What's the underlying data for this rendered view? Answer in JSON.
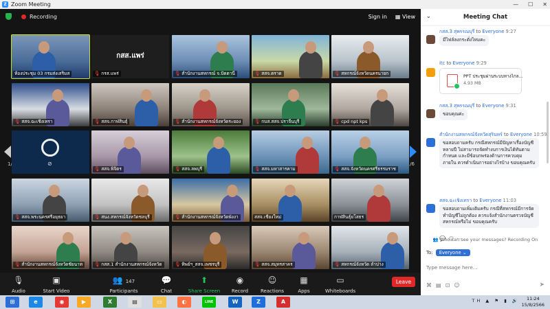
{
  "window": {
    "title": "Zoom Meeting",
    "logo": "Z",
    "controls": [
      "—",
      "☐",
      "✕"
    ]
  },
  "top": {
    "recording_label": "Recording",
    "signin_label": "Sign in",
    "view_label": "View"
  },
  "gallery": {
    "page_left": "1/6",
    "page_right": "1/6",
    "tiles": [
      {
        "name": "ห้องประชุม 03 กรมส่งเสริมส",
        "muted": false
      },
      {
        "name": "กรส.แพร่",
        "muted": true,
        "center_label": "กสส.แพร่"
      },
      {
        "name": "สำนักงานสหกรณ์ จ.ปัตตานี",
        "muted": true
      },
      {
        "name": "สสจ.ตราด",
        "muted": true
      },
      {
        "name": "สหกรณ์จังหวัดนครนายก",
        "muted": true
      },
      {
        "name": "สสจ.ฉะเชิงเทรา",
        "muted": true
      },
      {
        "name": "สสจ.กาฬสินธุ์",
        "muted": true
      },
      {
        "name": "สำนักงานสหกรณ์จังหวัดระยอง",
        "muted": true
      },
      {
        "name": "กบส.สสจ.ปราจีนบุรี",
        "muted": true
      },
      {
        "name": "cpd npt kps",
        "muted": true
      },
      {
        "name": "",
        "muted": false
      },
      {
        "name": "สสจ.พิจิตร",
        "muted": true
      },
      {
        "name": "สสจ.ลพบุรี",
        "muted": true
      },
      {
        "name": "สสจ.มหาสารคาม",
        "muted": true
      },
      {
        "name": "สสจ.จังหวัดนครศรีธรรมราช",
        "muted": true
      },
      {
        "name": "สสจ.พระนครศรีอยุธยา",
        "muted": true
      },
      {
        "name": "สนง.สหกรณ์จังหวัดชลบุรี",
        "muted": true
      },
      {
        "name": "สำนักงานสหกรณ์จังหวัดพังงา",
        "muted": true
      },
      {
        "name": "สสจ.เชียงใหม่",
        "muted": false
      },
      {
        "name": "กาฬสินธุ์ยโสธร",
        "muted": false
      },
      {
        "name": "สำนักงานสหกรณ์จังหวัดชัยนาท",
        "muted": true
      },
      {
        "name": "กสส.1 สำนักงานสหกรณ์จังหวัด",
        "muted": true
      },
      {
        "name": "ทิพย์ฯ_สสจ.เพชรบุรี",
        "muted": true
      },
      {
        "name": "สสจ.สมุทรสาคร",
        "muted": true
      },
      {
        "name": "สหกรณ์จังหวัด ลำปาง",
        "muted": true
      }
    ]
  },
  "toolbar": {
    "audio": "Audio",
    "video": "Start Video",
    "participants": "Participants",
    "participants_count": "147",
    "chat": "Chat",
    "share": "Share Screen",
    "record": "Record",
    "reactions": "Reactions",
    "apps": "Apps",
    "whiteboards": "Whiteboards",
    "leave": "Leave"
  },
  "chat": {
    "title": "Meeting Chat",
    "messages": [
      {
        "sender": "กสส.3 สุพรรณบุรี",
        "to": "to",
        "audience": "Everyone",
        "time": "9:27",
        "text": "มีไฟล์ลงกระดั่งไหมคะ",
        "avatar_color": "#6b4a3a"
      },
      {
        "sender": "itc",
        "to": "to",
        "audience": "Everyone",
        "time": "9:29",
        "file_name": "PPT ประชุมผ่านระบบทางไกล...",
        "file_size": "4.93 MB",
        "avatar_color": "#f59e0b"
      },
      {
        "sender": "กสส.3 สุพรรณบุรี",
        "to": "to",
        "audience": "Everyone",
        "time": "9:31",
        "text": "ขอบคุณค่ะ",
        "avatar_color": "#6b4a3a"
      },
      {
        "sender": "สำนักงานสหกรณ์จังหวัดสุรินทร์",
        "to": "to",
        "audience": "Everyone",
        "time": "10:59",
        "text": "ขอสอบถามครับ กรณีสหกรณ์มีปัญหาเรื่องบัญชีหลายปี ไม่สามารถจัดทำงบการเงินได้ทันตามกำหนด และมีข้อบกพร่องด้านการควบคุมภายใน ควรดำเนินการอย่างไรบ้าง ขอบคุณครับ",
        "avatar_color": "#2d6fd6"
      },
      {
        "sender": "สสจ.ฉะเชิงเทรา",
        "to": "to",
        "audience": "Everyone",
        "time": "11:03",
        "text": "ขอสอบถามเพิ่มเติมครับ กรณีที่สหกรณ์มีการจัดทำบัญชีไม่ถูกต้อง ควรแจ้งสำนักงานตรวจบัญชีสหกรณ์หรือไม่ ขอบคุณครับ",
        "avatar_color": "#2d6fd6"
      }
    ],
    "who_can_see": "Who can see your messages? Recording On",
    "to_label": "To:",
    "to_value": "Everyone",
    "placeholder": "Type message here..."
  },
  "taskbar": {
    "apps": [
      "⊞",
      "e",
      "◉",
      "▶",
      "X",
      "▤",
      "▭",
      "◐",
      "LINE",
      "W",
      "Z",
      "A"
    ],
    "tray_lang": "TH",
    "time": "11:24",
    "date": "15/8/2566"
  }
}
